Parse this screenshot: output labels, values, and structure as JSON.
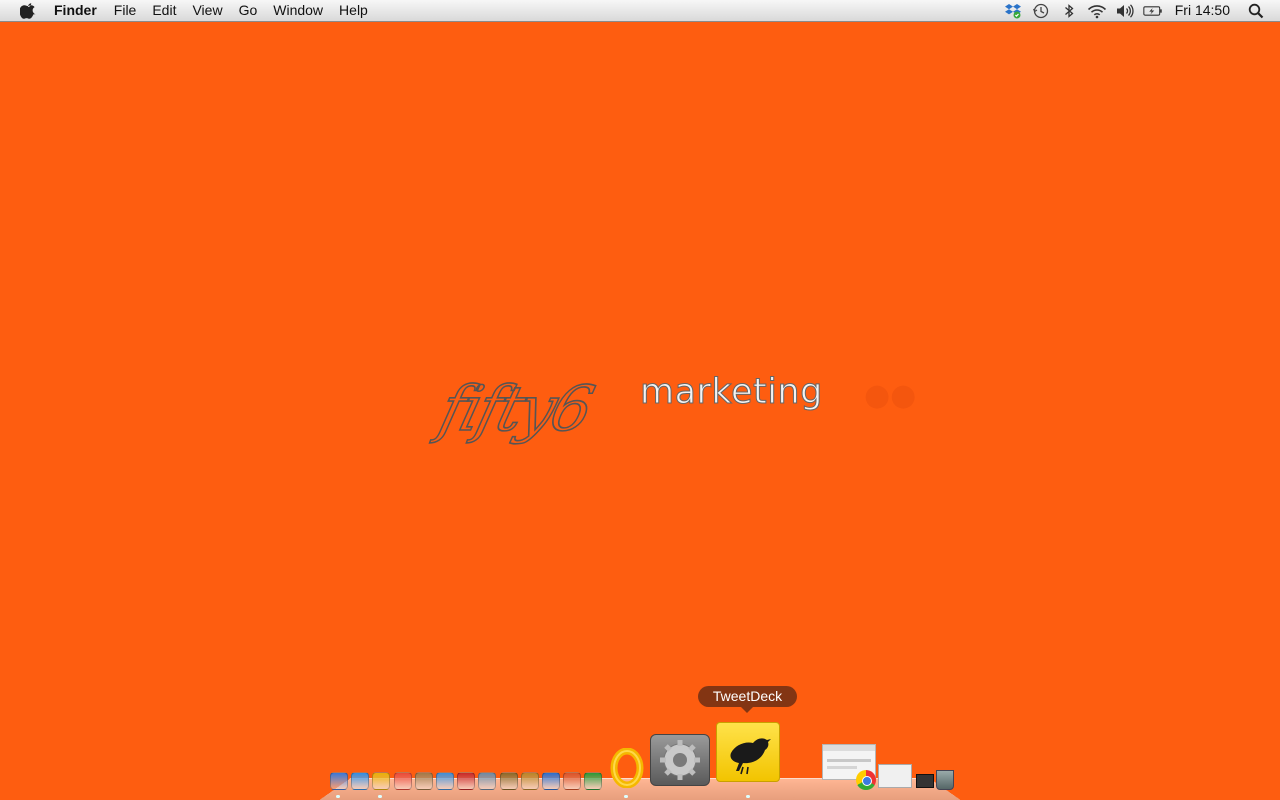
{
  "menubar": {
    "app_name": "Finder",
    "menus": [
      "File",
      "Edit",
      "View",
      "Go",
      "Window",
      "Help"
    ],
    "status_icons": [
      "dropbox-icon",
      "time-machine-icon",
      "bluetooth-icon",
      "wifi-icon",
      "volume-icon",
      "battery-icon"
    ],
    "clock": "Fri 14:50"
  },
  "desktop": {
    "background_color": "#fe5d10",
    "logo": {
      "script": "fifty6",
      "word": "marketing"
    }
  },
  "dock": {
    "tooltip": "TweetDeck",
    "apps": [
      {
        "name": "finder-icon",
        "color": "#3a78d8"
      },
      {
        "name": "app-store-icon",
        "color": "#2f8fe6"
      },
      {
        "name": "chrome-icon",
        "color": "#e8b10a"
      },
      {
        "name": "calendar-icon",
        "color": "#e84a3a"
      },
      {
        "name": "address-book-icon",
        "color": "#a07a4a"
      },
      {
        "name": "itunes-icon",
        "color": "#3e8fd9"
      },
      {
        "name": "photo-booth-icon",
        "color": "#c62a2a"
      },
      {
        "name": "preview-icon",
        "color": "#6c8aa6"
      },
      {
        "name": "imovie-icon",
        "color": "#8a6a2a"
      },
      {
        "name": "garageband-icon",
        "color": "#b8862a"
      },
      {
        "name": "word-icon",
        "color": "#2a6fcf"
      },
      {
        "name": "powerpoint-icon",
        "color": "#d9532a"
      },
      {
        "name": "excel-icon",
        "color": "#2a9a3a"
      },
      {
        "name": "outlook-icon",
        "color": "#f2b705"
      },
      {
        "name": "system-preferences-icon",
        "color": "#8a8a8a"
      },
      {
        "name": "tweetdeck-icon",
        "color": "#ffd21a"
      }
    ]
  }
}
